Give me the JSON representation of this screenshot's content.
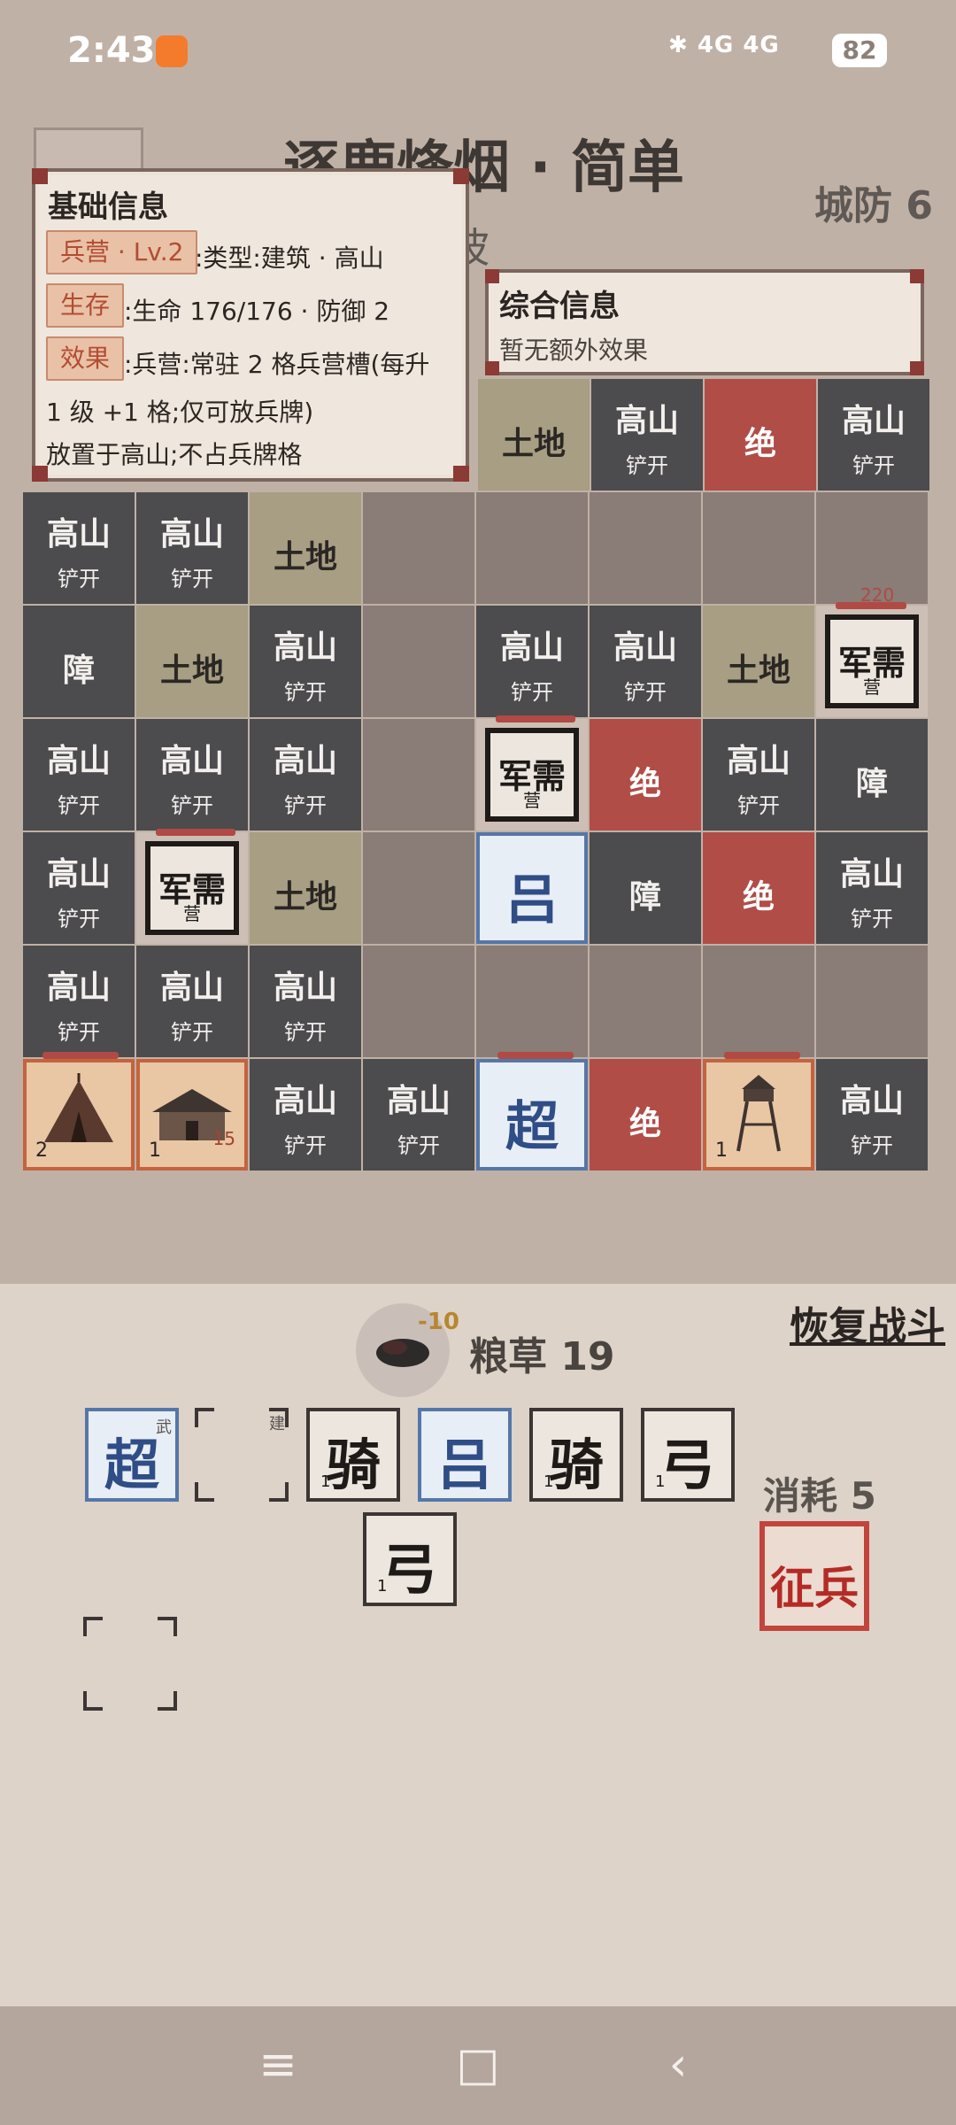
{
  "status": {
    "time": "2:43",
    "signal": "4G 4G",
    "battery": "82"
  },
  "header": {
    "title": "逐鹿烽烟 · 简单",
    "wave": "1波",
    "defense": "城防 6"
  },
  "info_panel": {
    "title": "基础信息",
    "tag1": "兵营 · Lv.2",
    "line1": ":类型:建筑 · 高山",
    "tag2": "生存",
    "line2": ":生命 176/176 · 防御 2",
    "tag3": "效果",
    "line3": ":兵营:常驻 2 格兵营槽(每升",
    "line4": "1 级 +1 格;仅可放兵牌)",
    "line5": "放置于高山;不占兵牌格"
  },
  "summary_panel": {
    "title": "综合信息",
    "text": "暂无额外效果"
  },
  "terrain_labels": {
    "mountain": "高山",
    "dig": "铲开",
    "soil": "土地",
    "absolute": "绝",
    "obstacle": "障"
  },
  "board": {
    "row0": [
      {
        "type": "soil",
        "col": 4
      },
      {
        "type": "mtn",
        "col": 5
      },
      {
        "type": "abs",
        "col": 6
      },
      {
        "type": "mtn",
        "col": 7
      }
    ],
    "row1": [
      "mtn",
      "mtn",
      "soil",
      "empty",
      "empty",
      "empty",
      "empty",
      "empty"
    ],
    "row2": [
      "obs",
      "soil",
      "mtn",
      "empty",
      "mtn",
      "mtn",
      "soil",
      "bldg"
    ],
    "row3": [
      "mtn",
      "mtn",
      "mtn",
      "empty",
      "bldg",
      "abs",
      "mtn",
      "obs"
    ],
    "row4": [
      "mtn",
      "bldg",
      "soil",
      "empty",
      "hero",
      "obs",
      "abs",
      "mtn"
    ],
    "row5": [
      "mtn",
      "mtn",
      "mtn",
      "empty",
      "empty",
      "empty",
      "empty",
      "empty"
    ],
    "row6": [
      "pic",
      "pic",
      "mtn",
      "mtn",
      "hero",
      "abs",
      "pic",
      "mtn"
    ]
  },
  "buildings": {
    "depot_name": "军需",
    "depot_sub": "营",
    "depot_hp": "220"
  },
  "heroes": {
    "lv": "吕",
    "chao": "超"
  },
  "pictures": [
    {
      "name": "tent",
      "level": "2",
      "count": ""
    },
    {
      "name": "barracks",
      "level": "1",
      "count": "15"
    },
    {
      "name": "watchtower",
      "level": "1",
      "count": ""
    }
  ],
  "resources": {
    "grain_label": "粮草 19",
    "grain_delta": "-10"
  },
  "actions": {
    "resume": "恢复战斗",
    "cost": "消耗 5",
    "recruit": "征兵"
  },
  "hand": [
    {
      "glyph": "超",
      "corner": "武",
      "num": ""
    },
    {
      "glyph": "",
      "corner": "建",
      "num": ""
    },
    {
      "glyph": "骑",
      "corner": "",
      "num": "1"
    },
    {
      "glyph": "吕",
      "corner": "",
      "num": ""
    },
    {
      "glyph": "骑",
      "corner": "",
      "num": "1"
    },
    {
      "glyph": "弓",
      "corner": "",
      "num": "1"
    },
    {
      "glyph": "弓",
      "corner": "",
      "num": "1"
    }
  ],
  "nav": {
    "menu": "≡",
    "home": "□",
    "back": "‹"
  }
}
